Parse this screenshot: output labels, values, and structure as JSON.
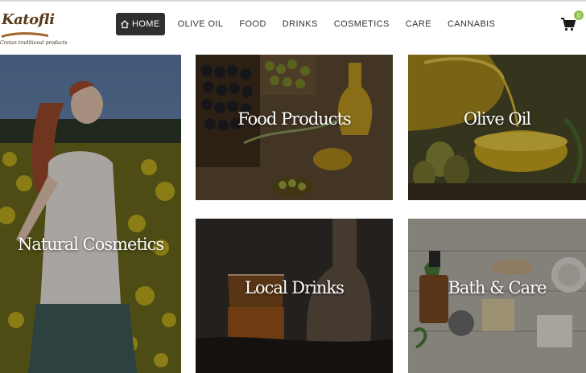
{
  "logo": {
    "name": "Katofli",
    "tagline": "Cretan traditional products"
  },
  "nav": {
    "items": [
      {
        "label": "HOME",
        "active": true,
        "icon": "home-icon"
      },
      {
        "label": "OLIVE OIL"
      },
      {
        "label": "FOOD"
      },
      {
        "label": "DRINKS"
      },
      {
        "label": "COSMETICS"
      },
      {
        "label": "CARE"
      },
      {
        "label": "CANNABIS"
      }
    ]
  },
  "cart": {
    "icon": "shopping-cart-icon",
    "count": "0",
    "badge_color": "#8bc34a"
  },
  "categories": {
    "cosmetics": {
      "label": "Natural Cosmetics"
    },
    "food": {
      "label": "Food Products"
    },
    "olive_oil": {
      "label": "Olive Oil"
    },
    "drinks": {
      "label": "Local Drinks"
    },
    "bath": {
      "label": "Bath & Care"
    }
  }
}
